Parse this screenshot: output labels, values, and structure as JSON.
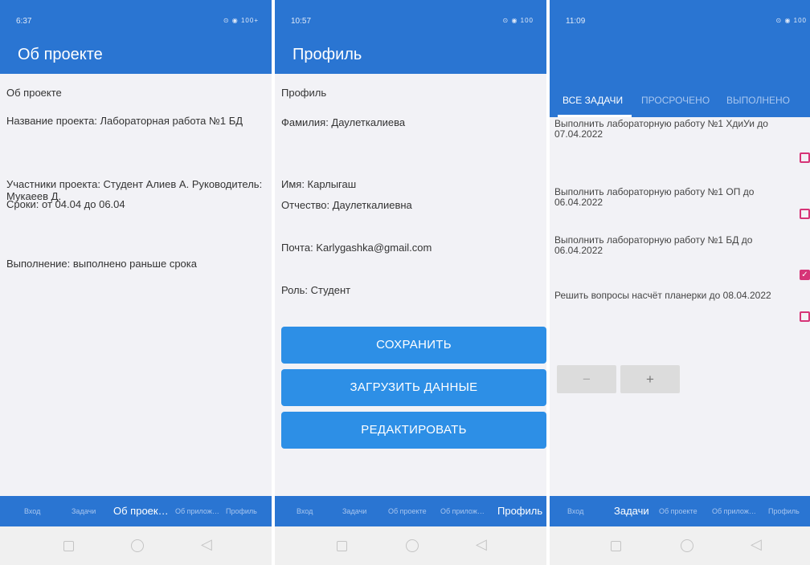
{
  "colors": {
    "primary": "#2a75d2",
    "button": "#2d8fe6",
    "checkbox": "#d63477"
  },
  "screens": {
    "about": {
      "time": "6:37",
      "status_icons": "⊙ ◉ 100+",
      "title": "Об проекте",
      "lines": [
        "Об проекте",
        "Название проекта: Лабораторная работа №1 БД",
        "Участники проекта: Студент Алиев А. Руководитель: Мукаеев Д.",
        "Сроки: от 04.04 до 06.04",
        "Выполнение: выполнено раньше срока"
      ],
      "nav": [
        "Вход",
        "Задачи",
        "Об проек…",
        "Об прилож…",
        "Профиль"
      ],
      "nav_active": 2
    },
    "profile": {
      "time": "10:57",
      "status_icons": "⊙ ◉ 100",
      "title": "Профиль",
      "lines": [
        "Профиль",
        "Фамилия:  Даулеткалиева",
        "Имя: Карлыгаш",
        "Отчество: Даулеткалиевна",
        "Почта: Karlygashka@gmail.com",
        "Роль: Студент"
      ],
      "buttons": [
        "СОХРАНИТЬ",
        "ЗАГРУЗИТЬ ДАННЫЕ",
        "РЕДАКТИРОВАТЬ"
      ],
      "nav": [
        "Вход",
        "Задачи",
        "Об проекте",
        "Об прилож…",
        "Профиль"
      ],
      "nav_active": 4
    },
    "tasks": {
      "time": "11:09",
      "status_icons": "⊙ ◉ 100",
      "tabs": [
        "ВСЕ ЗАДАЧИ",
        "ПРОСРОЧЕНО",
        "ВЫПОЛНЕНО"
      ],
      "tab_active": 0,
      "tasks": [
        {
          "text": "Выполнить лабораторную работу №1 ХдиУи  до 07.04.2022",
          "done": false
        },
        {
          "text": "Выполнить лабораторную работу №1 ОП  до 06.04.2022",
          "done": false
        },
        {
          "text": "Выполнить лабораторную работу №1 БД  до 06.04.2022",
          "done": true
        },
        {
          "text": "Решить вопросы насчёт планерки до 08.04.2022",
          "done": false
        }
      ],
      "stepper": {
        "minus": "−",
        "plus": "+"
      },
      "nav": [
        "Вход",
        "Задачи",
        "Об проекте",
        "Об прилож…",
        "Профиль"
      ],
      "nav_active": 1
    }
  },
  "system_icons": [
    "square-icon",
    "circle-icon",
    "back-triangle-icon"
  ]
}
